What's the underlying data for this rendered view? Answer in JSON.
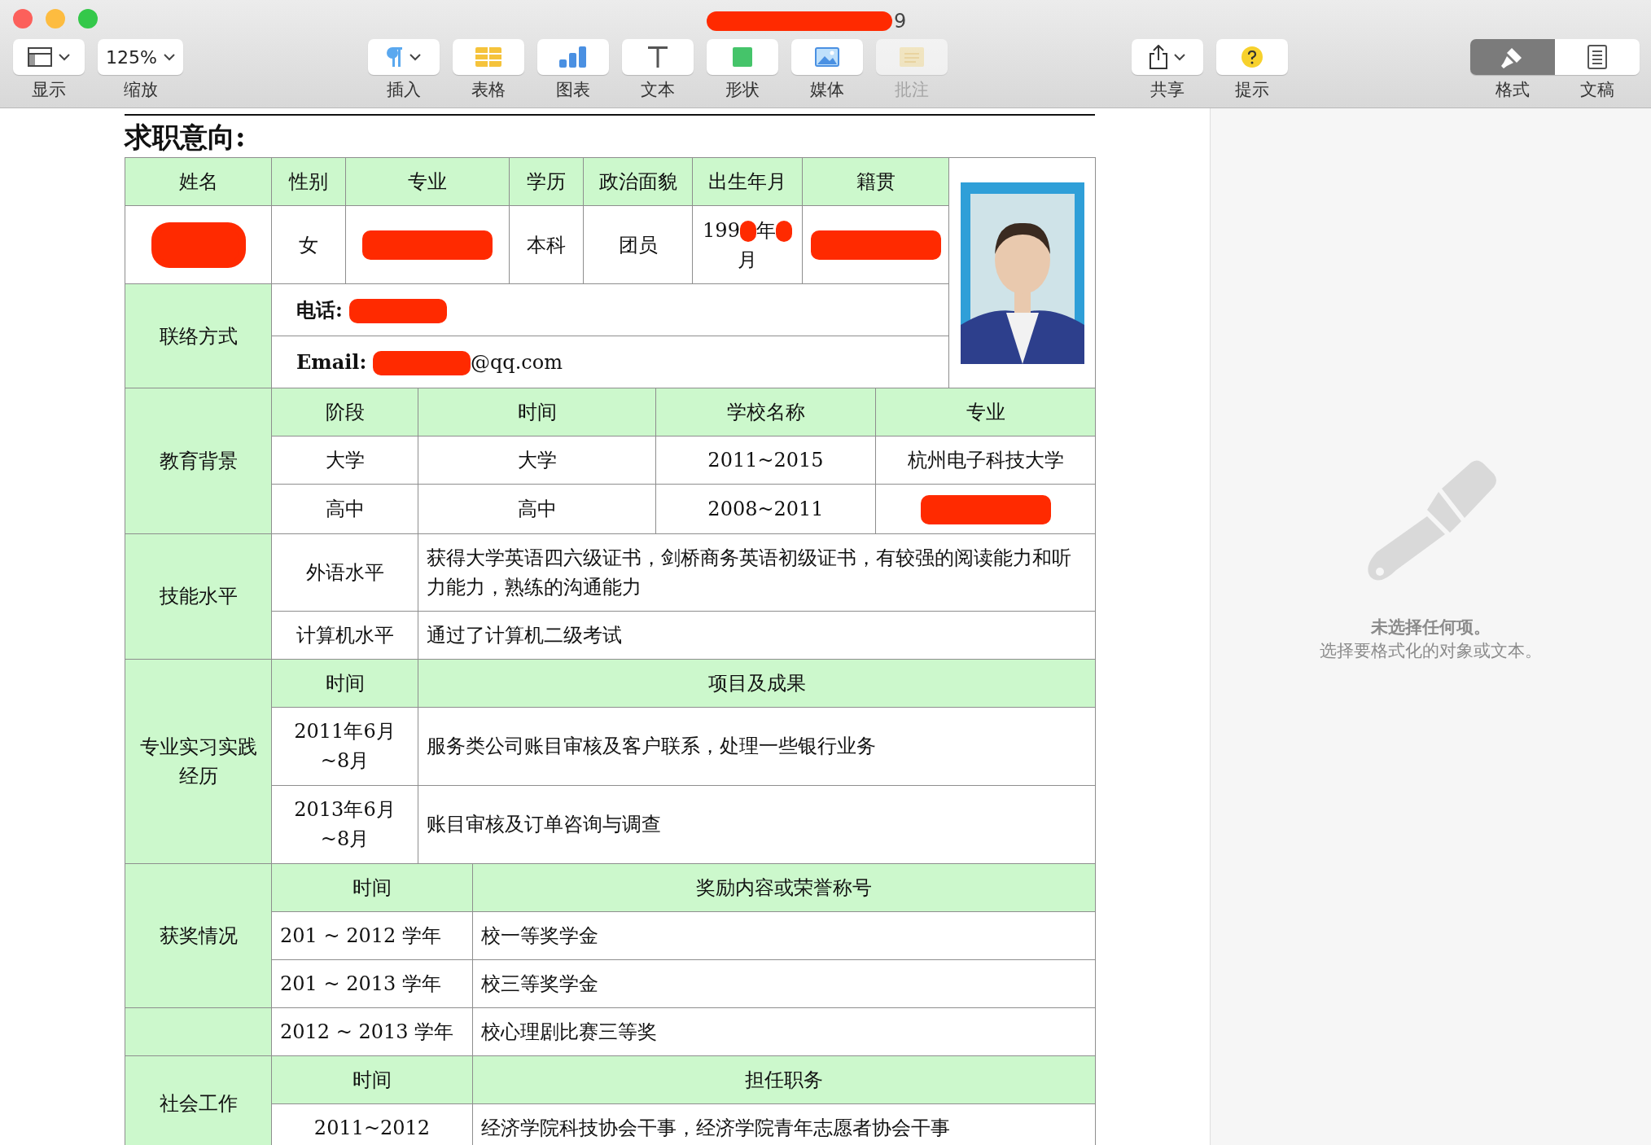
{
  "window": {
    "title": [
      {
        "kind": "redaction"
      },
      {
        "kind": "text",
        "text": "9"
      }
    ]
  },
  "toolbar": {
    "groups": [
      [
        {
          "kind": "view",
          "label": "显示",
          "dropdown": true,
          "disabled": false
        },
        {
          "kind": "zoom",
          "label": "缩放",
          "value": "125%",
          "dropdown": true,
          "disabled": false
        }
      ],
      [
        {
          "kind": "insert",
          "label": "插入",
          "dropdown": true,
          "disabled": false
        },
        {
          "kind": "table",
          "label": "表格",
          "dropdown": false,
          "disabled": false
        },
        {
          "kind": "chart",
          "label": "图表",
          "dropdown": false,
          "disabled": false
        },
        {
          "kind": "text",
          "label": "文本",
          "dropdown": false,
          "disabled": false
        },
        {
          "kind": "shape",
          "label": "形状",
          "dropdown": false,
          "disabled": false
        },
        {
          "kind": "media",
          "label": "媒体",
          "dropdown": false,
          "disabled": false
        },
        {
          "kind": "comment",
          "label": "批注",
          "dropdown": false,
          "disabled": true
        }
      ],
      [
        {
          "kind": "share",
          "label": "共享",
          "dropdown": true,
          "disabled": false
        },
        {
          "kind": "tips",
          "label": "提示",
          "dropdown": false,
          "disabled": false
        }
      ]
    ],
    "inspector_tabs": [
      {
        "kind": "format",
        "label": "格式",
        "selected": true
      },
      {
        "kind": "document",
        "label": "文稿",
        "selected": false
      }
    ]
  },
  "document": {
    "heading": "求职意向:",
    "basic": {
      "headers": [
        "姓名",
        "性别",
        "专业",
        "学历",
        "政治面貌",
        "出生年月",
        "籍贯"
      ],
      "values": [
        [
          {
            "kind": "redaction"
          }
        ],
        "女",
        [
          {
            "kind": "redaction"
          }
        ],
        "本科",
        "团员",
        [
          {
            "kind": "text",
            "text": "199"
          },
          {
            "kind": "redaction"
          },
          {
            "kind": "text",
            "text": "年"
          },
          {
            "kind": "redaction"
          },
          {
            "kind": "text",
            "text": "月"
          }
        ],
        [
          {
            "kind": "redaction"
          }
        ]
      ],
      "photo": {
        "kind": "picture"
      },
      "contact_label": "联络方式",
      "contacts": [
        {
          "label": "电话:",
          "value": [
            {
              "kind": "redaction"
            }
          ]
        },
        {
          "label": "Email:",
          "value": [
            {
              "kind": "redaction"
            },
            {
              "kind": "text",
              "text": "@qq.com"
            }
          ]
        }
      ]
    },
    "sections": [
      {
        "kind": "education",
        "label": "教育背景",
        "headers": [
          "阶段",
          "时间",
          "学校名称",
          "专业"
        ],
        "rows": [
          [
            "大学",
            "大学",
            "2011~2015",
            "杭州电子科技大学"
          ],
          [
            "高中",
            "高中",
            "2008~2011",
            [
              {
                "kind": "redaction"
              }
            ]
          ]
        ]
      },
      {
        "kind": "skills",
        "label": "技能水平",
        "rows": [
          [
            "外语水平",
            "获得大学英语四六级证书，剑桥商务英语初级证书，有较强的阅读能力和听力能力，熟练的沟通能力"
          ],
          [
            "计算机水平",
            "通过了计算机二级考试"
          ]
        ]
      },
      {
        "kind": "internship",
        "label": "专业实习实践经历",
        "headers": [
          "时间",
          "项目及成果"
        ],
        "rows": [
          [
            "2011年6月~8月",
            "服务类公司账目审核及客户联系，处理一些银行业务"
          ],
          [
            "2013年6月~8月",
            "账目审核及订单咨询与调查"
          ]
        ]
      },
      {
        "kind": "awards",
        "label": "获奖情况",
        "headers": [
          "时间",
          "奖励内容或荣誉称号"
        ],
        "rows": [
          [
            "201 ~ 2012 学年",
            "校一等奖学金"
          ],
          [
            "201 ~ 2013 学年",
            "校三等奖学金"
          ]
        ]
      },
      {
        "kind": "awards",
        "rows": [
          [
            "2012 ~ 2013 学年",
            "校心理剧比赛三等奖"
          ]
        ]
      },
      {
        "kind": "social",
        "label": "社会工作",
        "headers": [
          "时间",
          "担任职务"
        ],
        "rows": [
          [
            "2011~2012",
            "经济学院科技协会干事，经济学院青年志愿者协会干事"
          ]
        ]
      }
    ]
  },
  "sidebar": {
    "message": "未选择任何项。",
    "hint": "选择要格式化的对象或文本。"
  }
}
